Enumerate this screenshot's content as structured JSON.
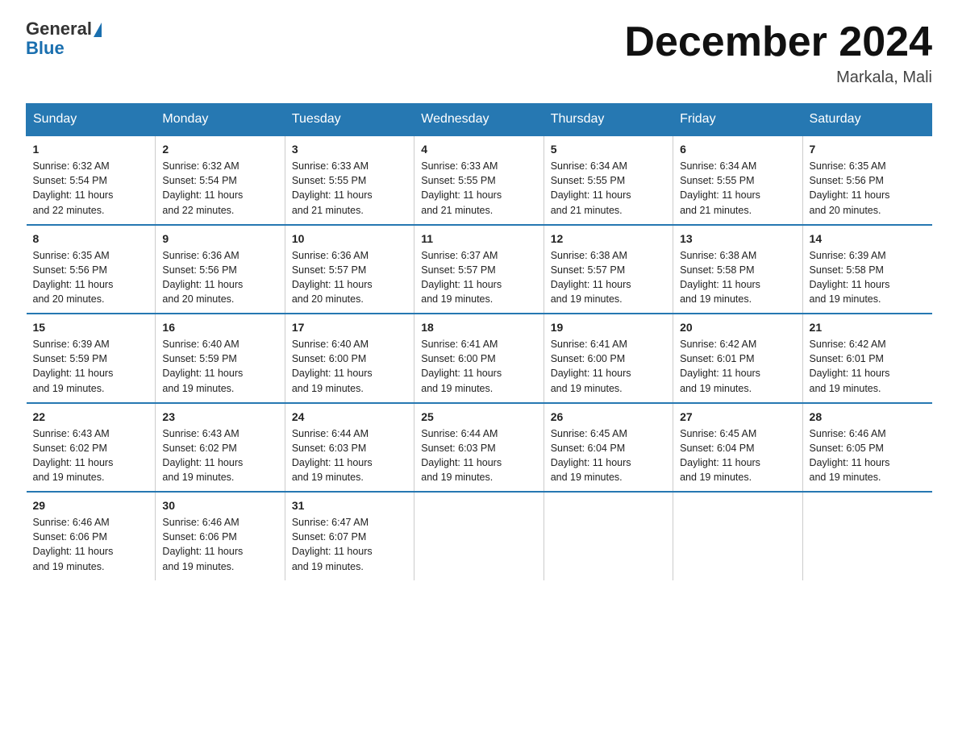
{
  "header": {
    "logo_line1": "General",
    "logo_line2": "Blue",
    "month_title": "December 2024",
    "location": "Markala, Mali"
  },
  "weekdays": [
    "Sunday",
    "Monday",
    "Tuesday",
    "Wednesday",
    "Thursday",
    "Friday",
    "Saturday"
  ],
  "weeks": [
    [
      {
        "day": "1",
        "info": "Sunrise: 6:32 AM\nSunset: 5:54 PM\nDaylight: 11 hours\nand 22 minutes."
      },
      {
        "day": "2",
        "info": "Sunrise: 6:32 AM\nSunset: 5:54 PM\nDaylight: 11 hours\nand 22 minutes."
      },
      {
        "day": "3",
        "info": "Sunrise: 6:33 AM\nSunset: 5:55 PM\nDaylight: 11 hours\nand 21 minutes."
      },
      {
        "day": "4",
        "info": "Sunrise: 6:33 AM\nSunset: 5:55 PM\nDaylight: 11 hours\nand 21 minutes."
      },
      {
        "day": "5",
        "info": "Sunrise: 6:34 AM\nSunset: 5:55 PM\nDaylight: 11 hours\nand 21 minutes."
      },
      {
        "day": "6",
        "info": "Sunrise: 6:34 AM\nSunset: 5:55 PM\nDaylight: 11 hours\nand 21 minutes."
      },
      {
        "day": "7",
        "info": "Sunrise: 6:35 AM\nSunset: 5:56 PM\nDaylight: 11 hours\nand 20 minutes."
      }
    ],
    [
      {
        "day": "8",
        "info": "Sunrise: 6:35 AM\nSunset: 5:56 PM\nDaylight: 11 hours\nand 20 minutes."
      },
      {
        "day": "9",
        "info": "Sunrise: 6:36 AM\nSunset: 5:56 PM\nDaylight: 11 hours\nand 20 minutes."
      },
      {
        "day": "10",
        "info": "Sunrise: 6:36 AM\nSunset: 5:57 PM\nDaylight: 11 hours\nand 20 minutes."
      },
      {
        "day": "11",
        "info": "Sunrise: 6:37 AM\nSunset: 5:57 PM\nDaylight: 11 hours\nand 19 minutes."
      },
      {
        "day": "12",
        "info": "Sunrise: 6:38 AM\nSunset: 5:57 PM\nDaylight: 11 hours\nand 19 minutes."
      },
      {
        "day": "13",
        "info": "Sunrise: 6:38 AM\nSunset: 5:58 PM\nDaylight: 11 hours\nand 19 minutes."
      },
      {
        "day": "14",
        "info": "Sunrise: 6:39 AM\nSunset: 5:58 PM\nDaylight: 11 hours\nand 19 minutes."
      }
    ],
    [
      {
        "day": "15",
        "info": "Sunrise: 6:39 AM\nSunset: 5:59 PM\nDaylight: 11 hours\nand 19 minutes."
      },
      {
        "day": "16",
        "info": "Sunrise: 6:40 AM\nSunset: 5:59 PM\nDaylight: 11 hours\nand 19 minutes."
      },
      {
        "day": "17",
        "info": "Sunrise: 6:40 AM\nSunset: 6:00 PM\nDaylight: 11 hours\nand 19 minutes."
      },
      {
        "day": "18",
        "info": "Sunrise: 6:41 AM\nSunset: 6:00 PM\nDaylight: 11 hours\nand 19 minutes."
      },
      {
        "day": "19",
        "info": "Sunrise: 6:41 AM\nSunset: 6:00 PM\nDaylight: 11 hours\nand 19 minutes."
      },
      {
        "day": "20",
        "info": "Sunrise: 6:42 AM\nSunset: 6:01 PM\nDaylight: 11 hours\nand 19 minutes."
      },
      {
        "day": "21",
        "info": "Sunrise: 6:42 AM\nSunset: 6:01 PM\nDaylight: 11 hours\nand 19 minutes."
      }
    ],
    [
      {
        "day": "22",
        "info": "Sunrise: 6:43 AM\nSunset: 6:02 PM\nDaylight: 11 hours\nand 19 minutes."
      },
      {
        "day": "23",
        "info": "Sunrise: 6:43 AM\nSunset: 6:02 PM\nDaylight: 11 hours\nand 19 minutes."
      },
      {
        "day": "24",
        "info": "Sunrise: 6:44 AM\nSunset: 6:03 PM\nDaylight: 11 hours\nand 19 minutes."
      },
      {
        "day": "25",
        "info": "Sunrise: 6:44 AM\nSunset: 6:03 PM\nDaylight: 11 hours\nand 19 minutes."
      },
      {
        "day": "26",
        "info": "Sunrise: 6:45 AM\nSunset: 6:04 PM\nDaylight: 11 hours\nand 19 minutes."
      },
      {
        "day": "27",
        "info": "Sunrise: 6:45 AM\nSunset: 6:04 PM\nDaylight: 11 hours\nand 19 minutes."
      },
      {
        "day": "28",
        "info": "Sunrise: 6:46 AM\nSunset: 6:05 PM\nDaylight: 11 hours\nand 19 minutes."
      }
    ],
    [
      {
        "day": "29",
        "info": "Sunrise: 6:46 AM\nSunset: 6:06 PM\nDaylight: 11 hours\nand 19 minutes."
      },
      {
        "day": "30",
        "info": "Sunrise: 6:46 AM\nSunset: 6:06 PM\nDaylight: 11 hours\nand 19 minutes."
      },
      {
        "day": "31",
        "info": "Sunrise: 6:47 AM\nSunset: 6:07 PM\nDaylight: 11 hours\nand 19 minutes."
      },
      {
        "day": "",
        "info": ""
      },
      {
        "day": "",
        "info": ""
      },
      {
        "day": "",
        "info": ""
      },
      {
        "day": "",
        "info": ""
      }
    ]
  ]
}
